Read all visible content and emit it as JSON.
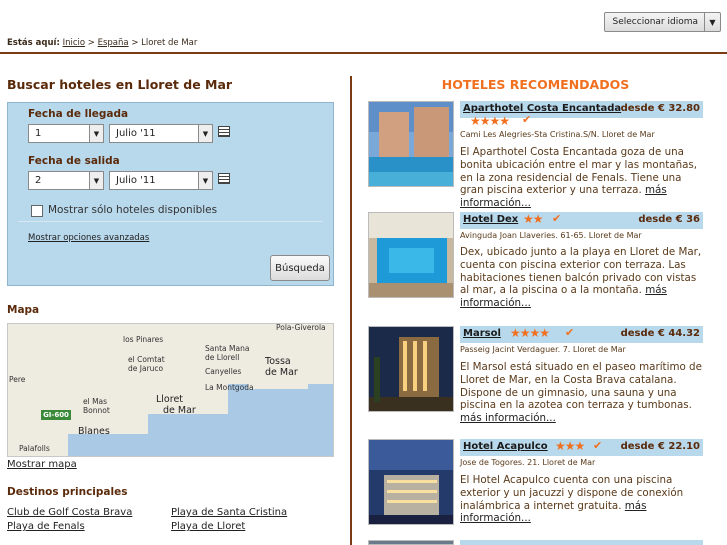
{
  "language_selector": {
    "label": "Seleccionar idioma"
  },
  "breadcrumb": {
    "prefix": "Estás aquí:",
    "home": "Inicio",
    "sep1": ">",
    "country": "España",
    "sep2": ">",
    "current": "Lloret de Mar"
  },
  "search": {
    "title": "Buscar hoteles en Lloret de Mar",
    "checkin_label": "Fecha de llegada",
    "checkin_day": "1",
    "checkin_month": "Julio '11",
    "checkout_label": "Fecha de salida",
    "checkout_day": "2",
    "checkout_month": "Julio '11",
    "available_only_label": "Mostrar sólo hoteles disponibles",
    "advanced_link": "Mostrar opciones avanzadas",
    "submit_label": "Búsqueda"
  },
  "map": {
    "title": "Mapa",
    "show_link": "Mostrar mapa",
    "labels": {
      "pola": "Pola-Giverola",
      "pinares": "los Pinares",
      "santa1": "Santa Mana",
      "santa2": "de Llorell",
      "comtat1": "el Comtat",
      "comtat2": "de Jaruco",
      "canyelles": "Canyelles",
      "tossa1": "Tossa",
      "tossa2": "de Mar",
      "pere": "Pere",
      "montgoda": "La Montgoda",
      "mas": "el Mas",
      "bonnot": "Bonnot",
      "lloret1": "Lloret",
      "lloret2": "de Mar",
      "road": "GI-600",
      "blanes": "Blanes",
      "palafolls": "Palafolls"
    }
  },
  "destinations": {
    "title": "Destinos principales",
    "items": [
      "Club de Golf Costa Brava",
      "Playa de Santa Cristina",
      "Playa de Fenals",
      "Playa de Lloret"
    ]
  },
  "recommended": {
    "title": "HOTELES RECOMENDADOS",
    "more_label": "más información...",
    "hotels": [
      {
        "name": "Aparthotel Costa Encantada",
        "stars": "★★★★",
        "stars_count": 4,
        "price": "desde € 32.80",
        "address": "Cami Les Alegries-Sta Cristina.S/N. Lloret de Mar",
        "desc": "El Aparthotel Costa Encantada goza de una bonita ubicación entre el mar y las montañas, en la zona residencial de Fenals. Tiene una gran piscina exterior y una terraza."
      },
      {
        "name": "Hotel Dex",
        "stars": "★★",
        "stars_count": 2,
        "price": "desde € 36",
        "address": "Avinguda Joan Llaveries. 61-65. Lloret de Mar",
        "desc": "Dex, ubicado junto a la playa en Lloret de Mar, cuenta con piscina exterior con terraza. Las habitaciones tienen balcón privado con vistas al mar, a la piscina o a la montaña."
      },
      {
        "name": "Marsol",
        "stars": "★★★★",
        "stars_count": 4,
        "price": "desde € 44.32",
        "address": "Passeig Jacint Verdaguer. 7. Lloret de Mar",
        "desc": "El Marsol está situado en el paseo marítimo de Lloret de Mar, en la Costa Brava catalana. Dispone de un gimnasio, una sauna y una piscina en la azotea con terraza y tumbonas."
      },
      {
        "name": "Hotel Acapulco",
        "stars": "★★★",
        "stars_count": 3,
        "price": "desde € 22.10",
        "address": "Jose de Togores. 21. Lloret de Mar",
        "desc": "El Hotel Acapulco cuenta con una piscina exterior y un jacuzzi y dispone de conexión inalámbrica a internet gratuita."
      }
    ]
  }
}
